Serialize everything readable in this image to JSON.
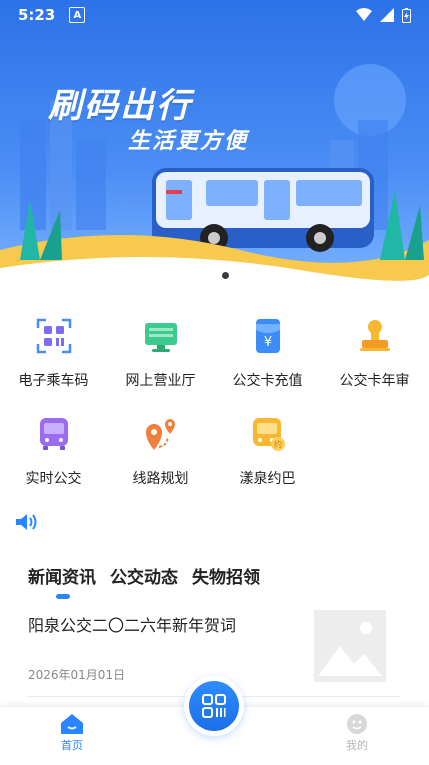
{
  "status_bar": {
    "time": "5:23",
    "notification_letter": "A"
  },
  "banner": {
    "title": "刷码出行",
    "subtitle": "生活更方便",
    "slide_count": 3,
    "active_slide": 3
  },
  "services": [
    {
      "label": "电子乘车码",
      "icon": "qr-code-icon"
    },
    {
      "label": "网上营业厅",
      "icon": "monitor-icon"
    },
    {
      "label": "公交卡充值",
      "icon": "yuan-card-icon"
    },
    {
      "label": "公交卡年审",
      "icon": "stamp-icon"
    },
    {
      "label": "实时公交",
      "icon": "bus-icon"
    },
    {
      "label": "线路规划",
      "icon": "route-icon"
    },
    {
      "label": "漾泉约巴",
      "icon": "booking-bus-icon"
    }
  ],
  "news": {
    "tabs": [
      "新闻资讯",
      "公交动态",
      "失物招领"
    ],
    "active_tab": 0,
    "items": [
      {
        "title": "阳泉公交二〇二六年新年贺词",
        "date": "2026年01月01日"
      }
    ]
  },
  "bottom_nav": {
    "home": "首页",
    "mine": "我的"
  },
  "colors": {
    "accent": "#2a86ff",
    "banner": "#2c72e8"
  }
}
